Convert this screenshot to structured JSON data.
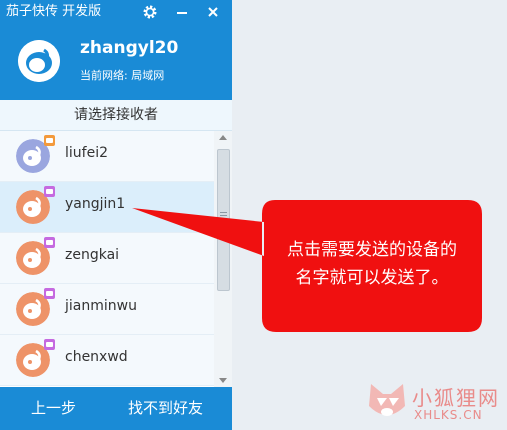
{
  "window": {
    "title": "茄子快传 开发版"
  },
  "header": {
    "username": "zhangyl20",
    "network_label": "当前网络:",
    "network_value": "局域网"
  },
  "section_title": "请选择接收者",
  "devices": [
    {
      "name": "liufei2",
      "badge_color": "#f39a3c",
      "avatar_color": "#9aa6df"
    },
    {
      "name": "yangjin1",
      "badge_color": "#c56ae0",
      "avatar_color": "#ee9368"
    },
    {
      "name": "zengkai",
      "badge_color": "#c56ae0",
      "avatar_color": "#ee9368"
    },
    {
      "name": "jianminwu",
      "badge_color": "#c56ae0",
      "avatar_color": "#ee9368"
    },
    {
      "name": "chenxwd",
      "badge_color": "#c56ae0",
      "avatar_color": "#ee9368"
    }
  ],
  "footer": {
    "back_label": "上一步",
    "not_found_label": "找不到好友"
  },
  "callout": {
    "line1": "点击需要发送的设备的",
    "line2": "名字就可以发送了。"
  },
  "watermark": {
    "cn": "小狐狸网",
    "en": "XHLKS.CN"
  },
  "colors": {
    "primary": "#1a8bd6",
    "callout": "#f01010"
  }
}
